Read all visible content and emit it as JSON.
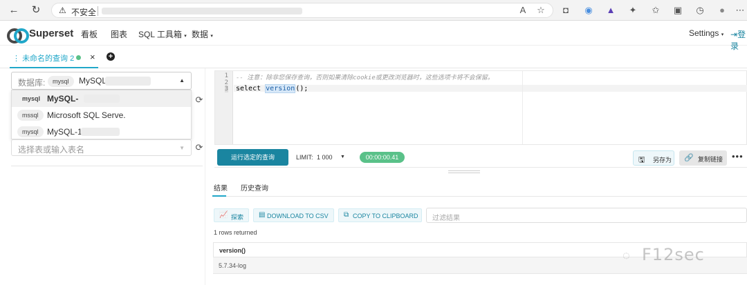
{
  "browser": {
    "security_label": "不安全",
    "icons": [
      "back-icon",
      "reload-icon",
      "warning-icon",
      "read-aloud-icon",
      "favorite-add-icon",
      "extensions-icon",
      "favorites-icon",
      "collections-icon",
      "history-icon",
      "profile-icon"
    ]
  },
  "header": {
    "brand": "Superset",
    "menu": [
      "看板",
      "图表",
      "SQL 工具箱",
      "数据"
    ],
    "settings": "Settings",
    "login": "登录"
  },
  "tabs": [
    {
      "label": "未命名的查询 2",
      "status": "success"
    }
  ],
  "left": {
    "db_label": "数据库:",
    "db_tag": "mysql",
    "db_value": "MySQL",
    "options": [
      {
        "tag": "mysql",
        "label": "MySQL-"
      },
      {
        "tag": "mssql",
        "label": "Microsoft SQL Serve."
      },
      {
        "tag": "mysql",
        "label": "MySQL-1"
      }
    ],
    "table_placeholder": "选择表或输入表名"
  },
  "editor": {
    "lines": [
      {
        "no": "1",
        "text": "--  注意：除非您保存查询，否则如果清除cookie或更改浏览器时，这些选项卡将不会保留。"
      },
      {
        "no": "2",
        "text": ""
      },
      {
        "no": "3",
        "text_pre": "select ",
        "text_fn": "version",
        "text_post": "();"
      }
    ]
  },
  "toolbar": {
    "run": "运行选定的查询",
    "limit_label": "LIMIT:",
    "limit_value": "1 000",
    "timer": "00:00:00.41",
    "save_as": "另存为",
    "copy_link": "复制链接"
  },
  "results": {
    "tabs": [
      "结果",
      "历史查询"
    ],
    "explore": "探索",
    "download_csv": "DOWNLOAD TO CSV",
    "copy_clipboard": "COPY TO CLIPBOARD",
    "filter_placeholder": "过滤结果",
    "rows_returned": "1 rows returned",
    "column": "version()",
    "value": "5.7.34-log"
  },
  "watermark": "F12sec",
  "colors": {
    "accent": "#20a7c9",
    "run_button": "#1a85a0",
    "success": "#5ac189"
  }
}
